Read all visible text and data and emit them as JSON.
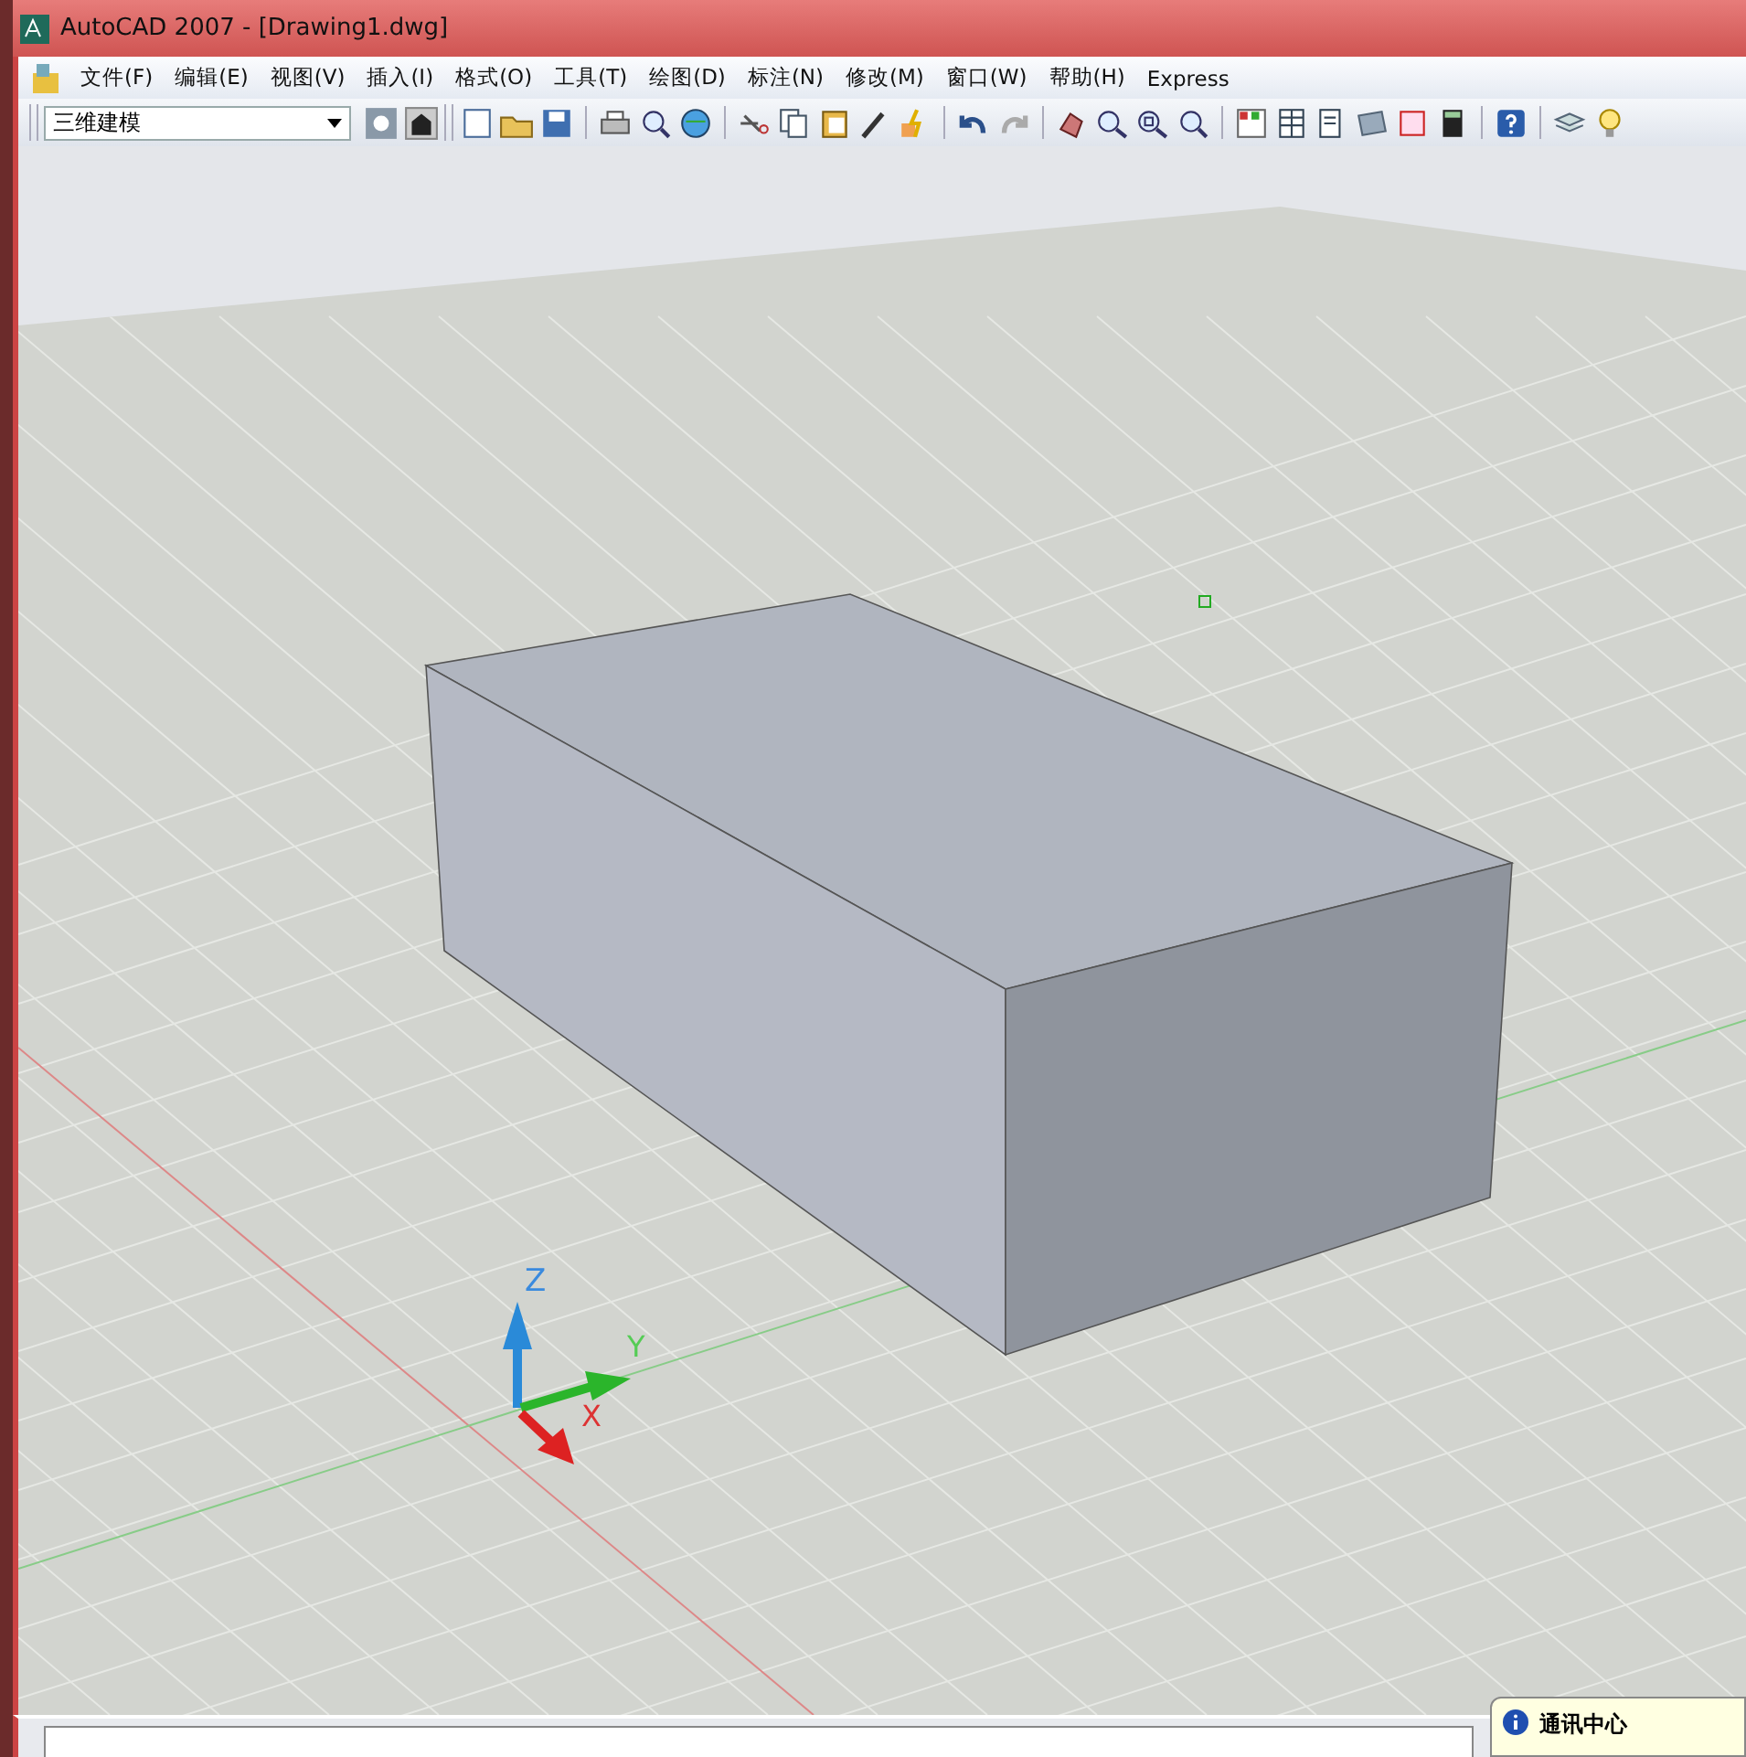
{
  "window": {
    "title": "AutoCAD 2007 - [Drawing1.dwg]"
  },
  "menu": [
    "文件(F)",
    "编辑(E)",
    "视图(V)",
    "插入(I)",
    "格式(O)",
    "工具(T)",
    "绘图(D)",
    "标注(N)",
    "修改(M)",
    "窗口(W)",
    "帮助(H)",
    "Express"
  ],
  "workspace": {
    "value": "三维建模"
  },
  "ucs": {
    "z": "Z",
    "y": "Y",
    "x": "X"
  },
  "balloon": {
    "title": "通讯中心"
  }
}
